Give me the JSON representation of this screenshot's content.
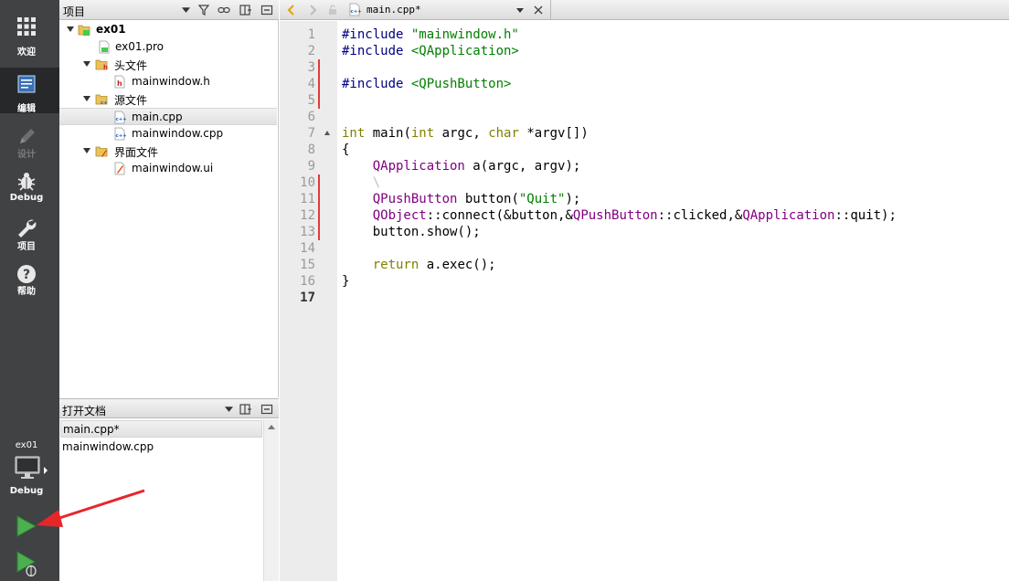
{
  "modebar": {
    "modes": [
      {
        "label": "欢迎",
        "icon": "grid-icon"
      },
      {
        "label": "编辑",
        "icon": "document-edit-icon"
      },
      {
        "label": "设计",
        "icon": "pencil-icon"
      },
      {
        "label": "Debug",
        "icon": "bug-icon"
      },
      {
        "label": "项目",
        "icon": "wrench-icon"
      },
      {
        "label": "帮助",
        "icon": "help-icon"
      }
    ],
    "active_mode": "编辑",
    "kit": {
      "project": "ex01",
      "build": "Debug"
    }
  },
  "project_pane": {
    "title": "项目",
    "tree": [
      {
        "label": "ex01",
        "icon": "qt-project-folder-icon",
        "bold": true
      },
      {
        "label": "ex01.pro",
        "icon": "pro-file-icon"
      },
      {
        "label": "头文件",
        "icon": "headers-folder-icon"
      },
      {
        "label": "mainwindow.h",
        "icon": "header-file-icon"
      },
      {
        "label": "源文件",
        "icon": "sources-folder-icon"
      },
      {
        "label": "main.cpp",
        "icon": "cpp-file-icon",
        "selected": true
      },
      {
        "label": "mainwindow.cpp",
        "icon": "cpp-file-icon"
      },
      {
        "label": "界面文件",
        "icon": "forms-folder-icon"
      },
      {
        "label": "mainwindow.ui",
        "icon": "ui-file-icon"
      }
    ]
  },
  "open_docs": {
    "title": "打开文档",
    "items": [
      {
        "label": "main.cpp*",
        "selected": true
      },
      {
        "label": "mainwindow.cpp"
      }
    ]
  },
  "editor": {
    "current_file": "main.cpp*",
    "current_line": 17,
    "line_numbers": [
      "1",
      "2",
      "3",
      "4",
      "5",
      "6",
      "7",
      "8",
      "9",
      "10",
      "11",
      "12",
      "13",
      "14",
      "15",
      "16",
      "17"
    ],
    "changed_lines": [
      3,
      4,
      5,
      10,
      11,
      12,
      13
    ],
    "lines": [
      [
        {
          "t": "#include ",
          "c": "pp"
        },
        {
          "t": "\"mainwindow.h\"",
          "c": "str"
        }
      ],
      [
        {
          "t": "#include ",
          "c": "pp"
        },
        {
          "t": "<QApplication>",
          "c": "str"
        }
      ],
      [],
      [
        {
          "t": "#include ",
          "c": "pp"
        },
        {
          "t": "<QPushButton>",
          "c": "str"
        }
      ],
      [],
      [],
      [
        {
          "t": "int",
          "c": "kw"
        },
        {
          "t": " main(",
          "c": ""
        },
        {
          "t": "int",
          "c": "kw"
        },
        {
          "t": " argc, ",
          "c": ""
        },
        {
          "t": "char",
          "c": "kw"
        },
        {
          "t": " *argv[])",
          "c": ""
        }
      ],
      [
        {
          "t": "{",
          "c": ""
        }
      ],
      [
        {
          "t": "    ",
          "c": ""
        },
        {
          "t": "QApplication",
          "c": "cls"
        },
        {
          "t": " a(argc, argv);",
          "c": ""
        }
      ],
      [
        {
          "t": "    ",
          "c": ""
        },
        {
          "t": "\\",
          "c": "ws"
        }
      ],
      [
        {
          "t": "    ",
          "c": ""
        },
        {
          "t": "QPushButton",
          "c": "cls"
        },
        {
          "t": " button(",
          "c": ""
        },
        {
          "t": "\"Quit\"",
          "c": "str"
        },
        {
          "t": ");",
          "c": ""
        }
      ],
      [
        {
          "t": "    ",
          "c": ""
        },
        {
          "t": "QObject",
          "c": "cls"
        },
        {
          "t": "::connect(&button,&",
          "c": ""
        },
        {
          "t": "QPushButton",
          "c": "cls"
        },
        {
          "t": "::clicked,&",
          "c": ""
        },
        {
          "t": "QApplication",
          "c": "cls"
        },
        {
          "t": "::quit);",
          "c": ""
        }
      ],
      [
        {
          "t": "    button.show();",
          "c": ""
        }
      ],
      [],
      [
        {
          "t": "    ",
          "c": ""
        },
        {
          "t": "return",
          "c": "kw"
        },
        {
          "t": " a.exec();",
          "c": ""
        }
      ],
      [
        {
          "t": "}",
          "c": ""
        }
      ],
      []
    ]
  },
  "colors": {
    "modebar_bg": "#404244",
    "modebar_active": "#262829",
    "gutter_bg": "#ececec",
    "change_marker": "#e23b3b",
    "run_green": "#4caf50",
    "annotation_arrow": "#e8262a"
  }
}
